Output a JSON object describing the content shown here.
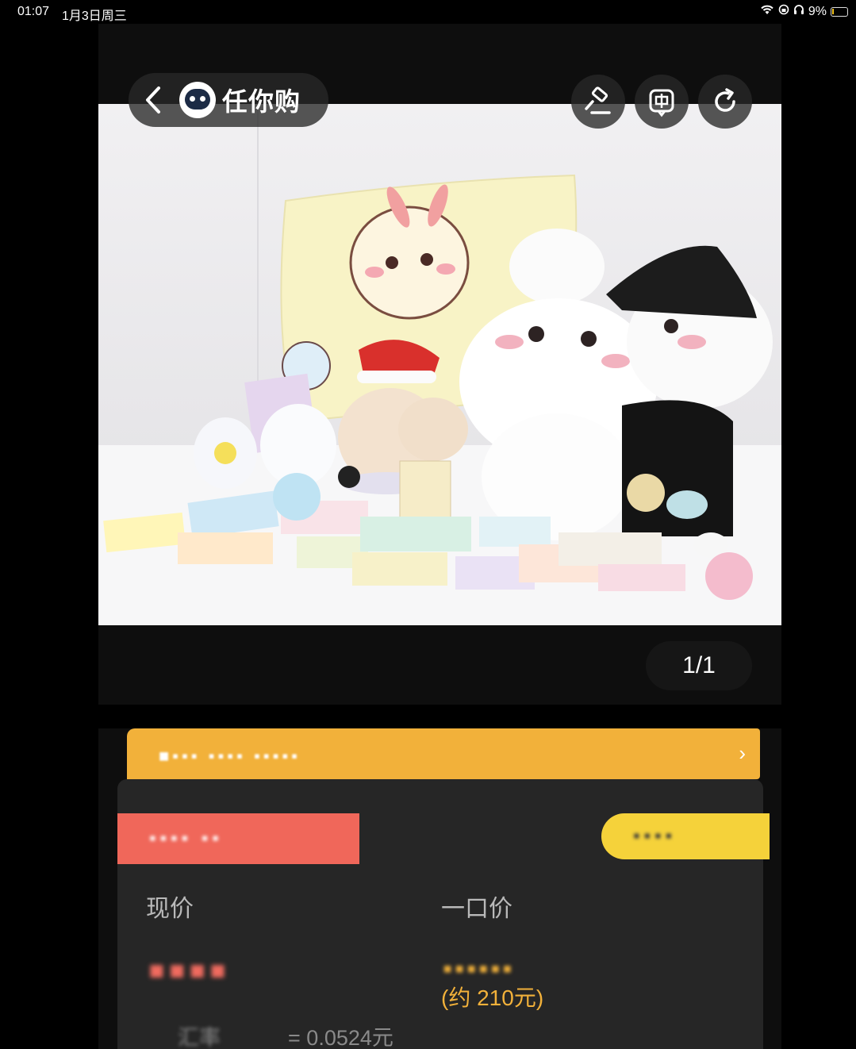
{
  "status_bar": {
    "time": "01:07",
    "date": "1月3日周三",
    "battery": "9%"
  },
  "nav": {
    "brand": "任你购"
  },
  "gallery": {
    "counter": "1/1"
  },
  "banner": {
    "text": "■▪▪▪ ▪▪▪▪ ▪▪▪▪▪"
  },
  "tags": {
    "left": "▪▪▪▪ ▪▪",
    "right": "▪▪▪▪"
  },
  "price": {
    "current_label": "现价",
    "current_value": "▪▪▪▪",
    "buyout_label": "一口价",
    "buyout_value": "▪▪▪▪▪▪",
    "buyout_approx": "(约 210元)",
    "rate_prefix": "汇率",
    "rate_value": "= 0.0524元"
  },
  "colors": {
    "banner": "#f2b13a",
    "tag_red": "#f0675a",
    "tag_yellow": "#f5d23a",
    "price_red": "#f06b5f",
    "price_orange": "#f2b13a"
  }
}
